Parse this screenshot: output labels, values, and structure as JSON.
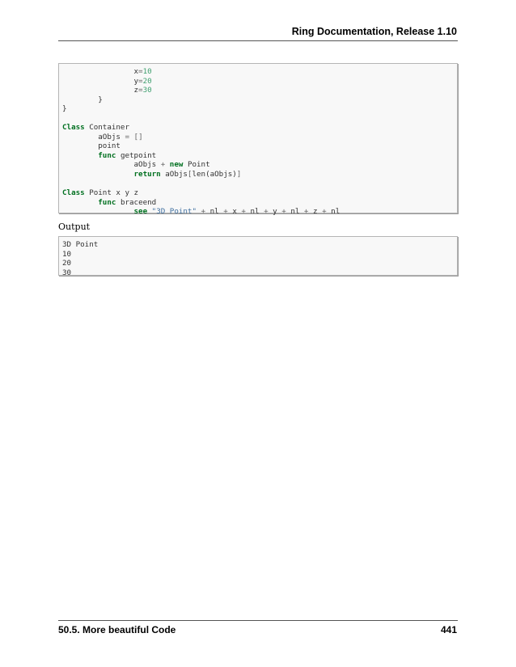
{
  "header": {
    "title": "Ring Documentation, Release 1.10"
  },
  "code_lines": [
    [
      {
        "t": "                x"
      },
      {
        "t": "=",
        "c": "op"
      },
      {
        "t": "10",
        "c": "num"
      }
    ],
    [
      {
        "t": "                y"
      },
      {
        "t": "=",
        "c": "op"
      },
      {
        "t": "20",
        "c": "num"
      }
    ],
    [
      {
        "t": "                z"
      },
      {
        "t": "=",
        "c": "op"
      },
      {
        "t": "30",
        "c": "num"
      }
    ],
    [
      {
        "t": "        }"
      }
    ],
    [
      {
        "t": "}"
      }
    ],
    [
      {
        "t": ""
      }
    ],
    [
      {
        "t": "Class",
        "c": "kw"
      },
      {
        "t": " Container"
      }
    ],
    [
      {
        "t": "        aObjs "
      },
      {
        "t": "=",
        "c": "op"
      },
      {
        "t": " "
      },
      {
        "t": "[]",
        "c": "op"
      }
    ],
    [
      {
        "t": "        point"
      }
    ],
    [
      {
        "t": "        "
      },
      {
        "t": "func",
        "c": "kw"
      },
      {
        "t": " getpoint"
      }
    ],
    [
      {
        "t": "                aObjs "
      },
      {
        "t": "+",
        "c": "op"
      },
      {
        "t": " "
      },
      {
        "t": "new",
        "c": "kw"
      },
      {
        "t": " Point"
      }
    ],
    [
      {
        "t": "                "
      },
      {
        "t": "return",
        "c": "kw"
      },
      {
        "t": " aObjs"
      },
      {
        "t": "[",
        "c": "op"
      },
      {
        "t": "len(aObjs)"
      },
      {
        "t": "]",
        "c": "op"
      }
    ],
    [
      {
        "t": ""
      }
    ],
    [
      {
        "t": "Class",
        "c": "kw"
      },
      {
        "t": " Point x y z"
      }
    ],
    [
      {
        "t": "        "
      },
      {
        "t": "func",
        "c": "kw"
      },
      {
        "t": " braceend"
      }
    ],
    [
      {
        "t": "                "
      },
      {
        "t": "see",
        "c": "kw"
      },
      {
        "t": " "
      },
      {
        "t": "\"3D Point\"",
        "c": "str"
      },
      {
        "t": " "
      },
      {
        "t": "+",
        "c": "op"
      },
      {
        "t": " nl "
      },
      {
        "t": "+",
        "c": "op"
      },
      {
        "t": " x "
      },
      {
        "t": "+",
        "c": "op"
      },
      {
        "t": " nl "
      },
      {
        "t": "+",
        "c": "op"
      },
      {
        "t": " y "
      },
      {
        "t": "+",
        "c": "op"
      },
      {
        "t": " nl "
      },
      {
        "t": "+",
        "c": "op"
      },
      {
        "t": " z "
      },
      {
        "t": "+",
        "c": "op"
      },
      {
        "t": " nl"
      }
    ]
  ],
  "output_label": "Output",
  "output_lines": [
    "3D Point",
    "10",
    "20",
    "30"
  ],
  "footer": {
    "section": "50.5. More beautiful Code",
    "page_number": "441"
  }
}
